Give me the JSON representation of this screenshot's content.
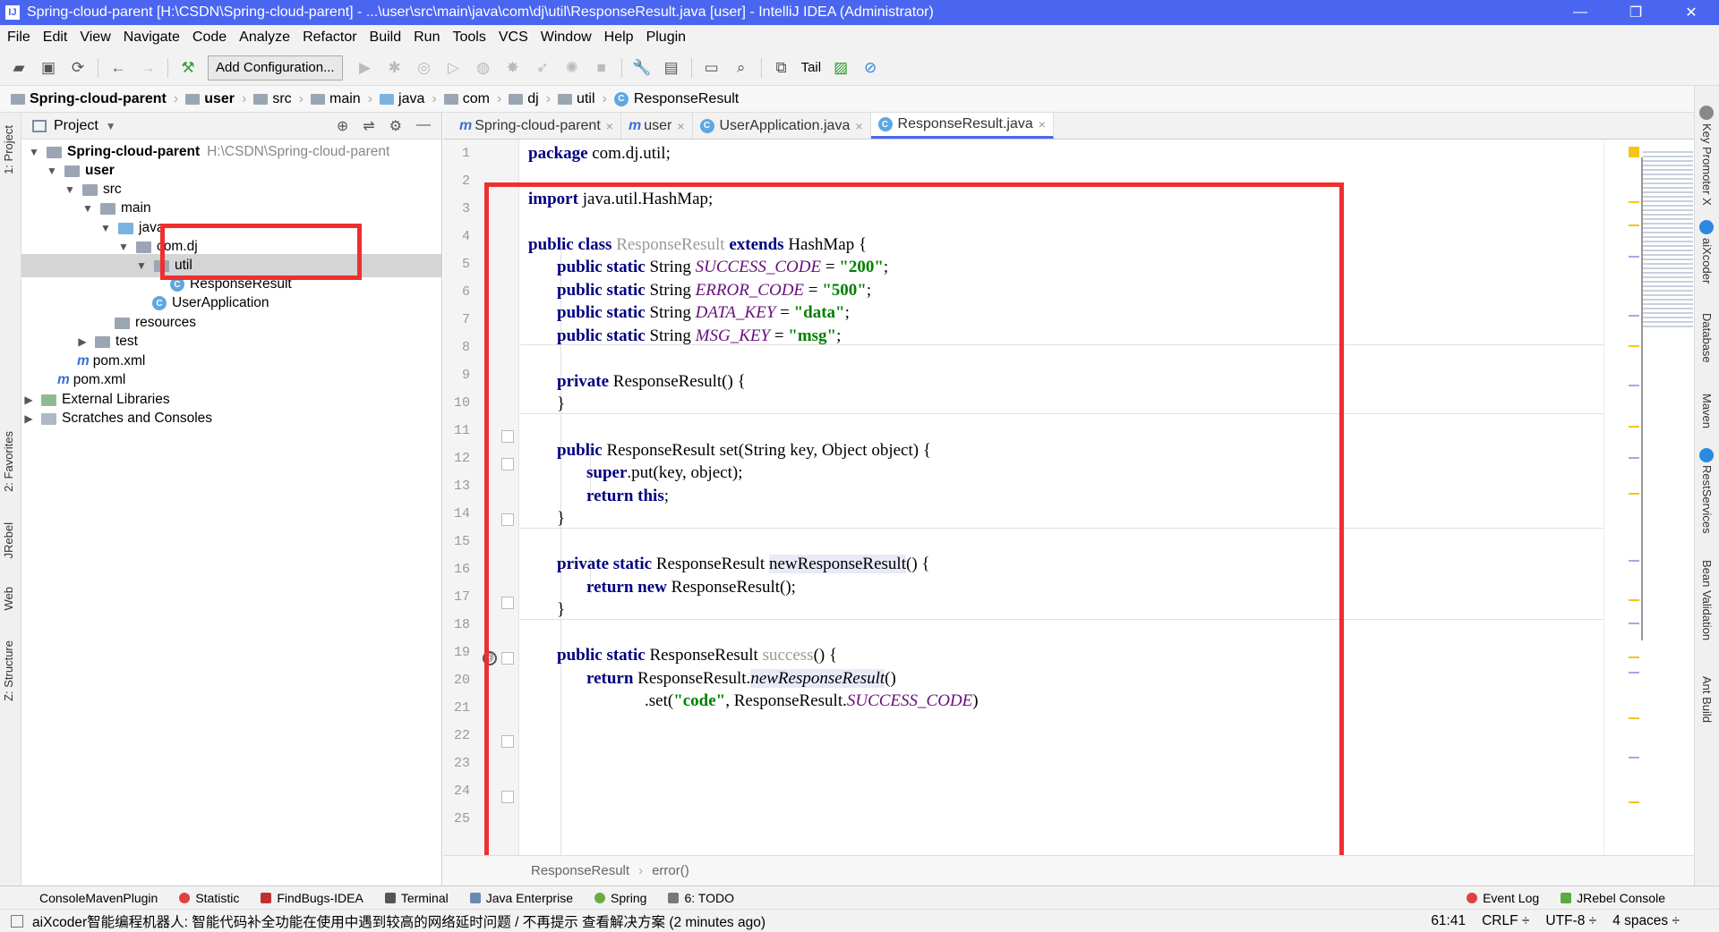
{
  "window": {
    "title": "Spring-cloud-parent [H:\\CSDN\\Spring-cloud-parent] - ...\\user\\src\\main\\java\\com\\dj\\util\\ResponseResult.java [user] - IntelliJ IDEA (Administrator)",
    "app_icon": "IJ",
    "minimize": "—",
    "maximize": "❐",
    "close": "✕"
  },
  "menu": [
    "File",
    "Edit",
    "View",
    "Navigate",
    "Code",
    "Analyze",
    "Refactor",
    "Build",
    "Run",
    "Tools",
    "VCS",
    "Window",
    "Help",
    "Plugin"
  ],
  "toolbar": {
    "add_configuration": "Add Configuration...",
    "tail": "Tail"
  },
  "breadcrumbs": [
    "Spring-cloud-parent",
    "user",
    "src",
    "main",
    "java",
    "com",
    "dj",
    "util",
    "ResponseResult"
  ],
  "left_strip": {
    "project": "1: Project",
    "favorites": "2: Favorites",
    "jrebel": "JRebel",
    "web": "Web",
    "structure": "Z: Structure"
  },
  "project_panel": {
    "title": "Project",
    "tree": [
      {
        "label": "Spring-cloud-parent",
        "path": "H:\\CSDN\\Spring-cloud-parent"
      },
      {
        "label": "user"
      },
      {
        "label": "src"
      },
      {
        "label": "main"
      },
      {
        "label": "java"
      },
      {
        "label": "com.dj"
      },
      {
        "label": "util"
      },
      {
        "label": "ResponseResult"
      },
      {
        "label": "UserApplication"
      },
      {
        "label": "resources"
      },
      {
        "label": "test"
      },
      {
        "label": "pom.xml"
      },
      {
        "label": "pom.xml"
      },
      {
        "label": "External Libraries"
      },
      {
        "label": "Scratches and Consoles"
      }
    ]
  },
  "editor_tabs": [
    {
      "label": "Spring-cloud-parent",
      "icon": "m"
    },
    {
      "label": "user",
      "icon": "m"
    },
    {
      "label": "UserApplication.java",
      "icon": "C"
    },
    {
      "label": "ResponseResult.java",
      "icon": "C"
    }
  ],
  "code": {
    "line_numbers": [
      "1",
      "2",
      "3",
      "4",
      "5",
      "6",
      "7",
      "8",
      "9",
      "10",
      "11",
      "12",
      "13",
      "14",
      "15",
      "16",
      "17",
      "18",
      "19",
      "20",
      "21",
      "22",
      "23",
      "24",
      "25"
    ],
    "l1a": "package",
    "l1b": " com.dj.util;",
    "l3a": "import",
    "l3b": " java.util.HashMap;",
    "l5a": "public class",
    "l5b": " ResponseResult",
    "l5c": " extends",
    "l5d": " HashMap {",
    "l6a": "public static",
    "l6b": " String ",
    "l6c": "SUCCESS_CODE",
    "l6d": " = ",
    "l6e": "\"200\"",
    "l6f": ";",
    "l7a": "public static",
    "l7b": " String ",
    "l7c": "ERROR_CODE",
    "l7d": " = ",
    "l7e": "\"500\"",
    "l7f": ";",
    "l8a": "public static",
    "l8b": " String ",
    "l8c": "DATA_KEY",
    "l8d": " = ",
    "l8e": "\"data\"",
    "l8f": ";",
    "l9a": "public static",
    "l9b": " String ",
    "l9c": "MSG_KEY",
    "l9d": " = ",
    "l9e": "\"msg\"",
    "l9f": ";",
    "l11a": "private",
    "l11b": " ResponseResult() {",
    "l12": "}",
    "l14a": "public",
    "l14b": " ResponseResult set(String key, Object object) {",
    "l15a": "super",
    "l15b": ".put(key, object);",
    "l16a": "return this",
    "l16b": ";",
    "l17": "}",
    "l19a": "private static",
    "l19b": " ResponseResult ",
    "l19c": "newResponseResult",
    "l19d": "() {",
    "l20a": "return new",
    "l20b": " ResponseResult();",
    "l21": "}",
    "l23a": "public static",
    "l23b": " ResponseResult ",
    "l23c": "success",
    "l23d": "() {",
    "l24a": "return",
    "l24b": " ResponseResult.",
    "l24c": "newResponseResult",
    "l24d": "()",
    "l25a": ".set(",
    "l25b": "\"code\"",
    "l25c": ", ResponseResult.",
    "l25d": "SUCCESS_CODE",
    "l25e": ")"
  },
  "footer_breadcrumb": [
    "ResponseResult",
    "error()"
  ],
  "right_strip": [
    "Key Promoter X",
    "aiXcoder",
    "Database",
    "Maven",
    "RestServices",
    "Bean Validation",
    "Ant Build"
  ],
  "tool_windows": [
    "ConsoleMavenPlugin",
    "Statistic",
    "FindBugs-IDEA",
    "Terminal",
    "Java Enterprise",
    "Spring",
    "6: TODO",
    "Event Log",
    "JRebel Console"
  ],
  "status": {
    "message": "aiXcoder智能编程机器人: 智能代码补全功能在使用中遇到较高的网络延时问题 / 不再提示 查看解决方案 (2 minutes ago)",
    "position": "61:41",
    "line_sep": "CRLF ÷",
    "encoding": "UTF-8 ÷",
    "indent": "4 spaces ÷"
  },
  "colors": {
    "title_bar": "#4a66f0",
    "annotation_red": "#ef2f2f",
    "keyword": "#000080",
    "string": "#008000",
    "constant": "#660e7a"
  }
}
